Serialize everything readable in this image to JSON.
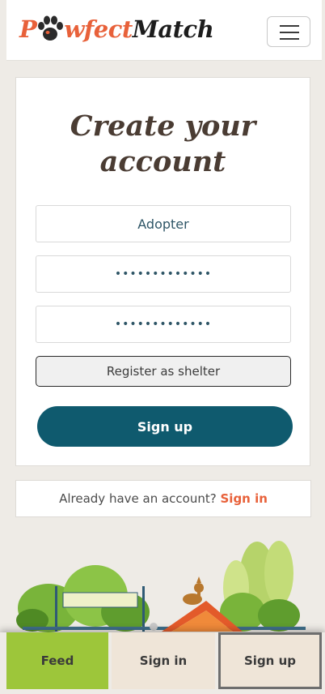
{
  "header": {
    "logo_part1": "P",
    "logo_part2": "wfect",
    "logo_part3": "Match",
    "paw_icon": "paw-icon",
    "menu_icon": "hamburger-icon"
  },
  "form": {
    "title_line1": "Create your",
    "title_line2": "account",
    "role_value": "Adopter",
    "password_value": "•••••••••••••",
    "confirm_value": "•••••••••••••",
    "shelter_button": "Register as shelter",
    "signup_button": "Sign up"
  },
  "signin_prompt": {
    "text": "Already have an account?",
    "link": "Sign in"
  },
  "nav": {
    "feed": "Feed",
    "signin": "Sign in",
    "signup": "Sign up"
  },
  "colors": {
    "accent": "#e8613a",
    "primary": "#0f5a6e",
    "feed_tab": "#9dc63a"
  }
}
